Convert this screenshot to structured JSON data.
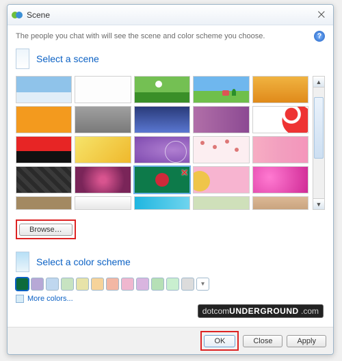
{
  "window": {
    "title": "Scene",
    "close_glyph": "⨉"
  },
  "desc": "The people you chat with will see the scene and color scheme you choose.",
  "help_glyph": "?",
  "section_scene": "Select a scene",
  "section_scheme": "Select a color scheme",
  "browse_label": "Browse…",
  "more_colors": "More colors...",
  "buttons": {
    "ok": "OK",
    "close": "Close",
    "apply": "Apply"
  },
  "selected_scene_index": 17,
  "selected_swatch_index": 0,
  "scenes": [
    {
      "name": "sky-gradient"
    },
    {
      "name": "white-blank"
    },
    {
      "name": "green-hill-clouds"
    },
    {
      "name": "summer-field-house"
    },
    {
      "name": "golden-wheat"
    },
    {
      "name": "orange-solid"
    },
    {
      "name": "gray-landscape"
    },
    {
      "name": "navy-night"
    },
    {
      "name": "purple-violet"
    },
    {
      "name": "white-red-flower"
    },
    {
      "name": "red-black-split"
    },
    {
      "name": "yellow-gradient"
    },
    {
      "name": "purple-swirl"
    },
    {
      "name": "pink-blossom"
    },
    {
      "name": "pink-stripes"
    },
    {
      "name": "dark-cubes"
    },
    {
      "name": "magenta-star"
    },
    {
      "name": "bangladesh-flag"
    },
    {
      "name": "pink-sun"
    },
    {
      "name": "hot-pink-glow"
    },
    {
      "name": "tan-partial"
    },
    {
      "name": "white-partial"
    },
    {
      "name": "teal-partial"
    },
    {
      "name": "sage-partial"
    },
    {
      "name": "beige-partial"
    }
  ],
  "swatches": [
    "#0d6b3c",
    "#b7a8d6",
    "#bfd7ef",
    "#c7e3c1",
    "#e7e3a8",
    "#f6d39a",
    "#f3b7a4",
    "#efb7cf",
    "#d9b5e0",
    "#b6e0b6",
    "#c9efcf",
    "#dcdcdc"
  ],
  "watermark": {
    "p1": "dotcom",
    "p2": "UNDERGROUND",
    "p3": " .com"
  }
}
